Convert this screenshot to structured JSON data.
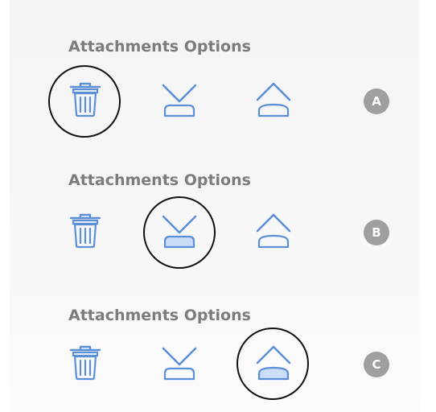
{
  "sections": [
    {
      "title": "Attachments Options",
      "label": "A",
      "highlighted_action": "delete",
      "actions": [
        {
          "id": "delete",
          "icon": "trash-icon",
          "active": false
        },
        {
          "id": "move-down",
          "icon": "chevron-down-icon",
          "active": false
        },
        {
          "id": "move-up",
          "icon": "chevron-up-icon",
          "active": false
        }
      ]
    },
    {
      "title": "Attachments Options",
      "label": "B",
      "highlighted_action": "move-down",
      "actions": [
        {
          "id": "delete",
          "icon": "trash-icon",
          "active": false
        },
        {
          "id": "move-down",
          "icon": "chevron-down-icon",
          "active": true
        },
        {
          "id": "move-up",
          "icon": "chevron-up-icon",
          "active": false
        }
      ]
    },
    {
      "title": "Attachments Options",
      "label": "C",
      "highlighted_action": "move-up",
      "actions": [
        {
          "id": "delete",
          "icon": "trash-icon",
          "active": false
        },
        {
          "id": "move-down",
          "icon": "chevron-down-icon",
          "active": false
        },
        {
          "id": "move-up",
          "icon": "chevron-up-icon",
          "active": true
        }
      ]
    }
  ],
  "colors": {
    "icon_stroke": "#5b8fd6",
    "icon_fill_active": "#c9ddf6",
    "title_text": "#7c7c7c",
    "badge_bg": "#9f9f9f",
    "highlight_ring": "#111111"
  }
}
